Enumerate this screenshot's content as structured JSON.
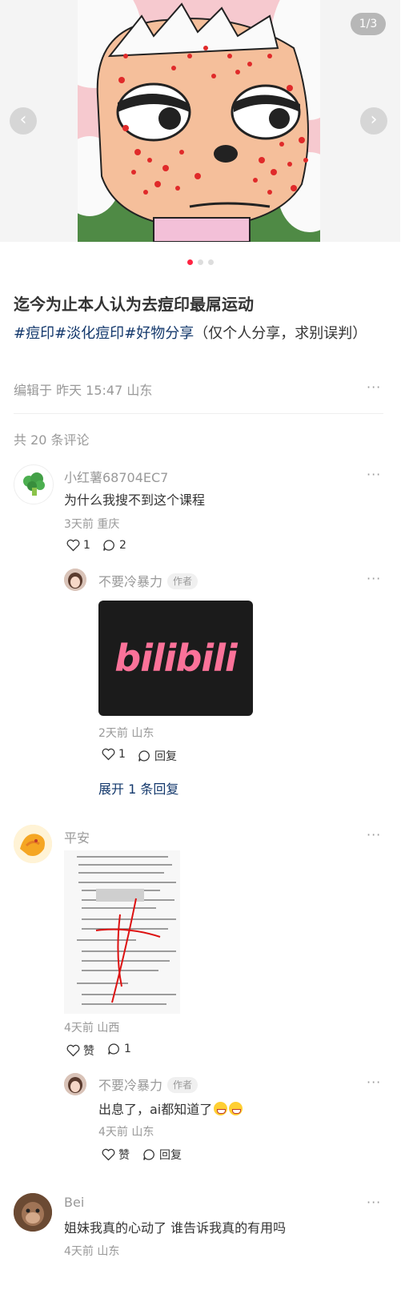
{
  "carousel": {
    "counter": "1/3",
    "prev_icon": "chevron-left-icon",
    "next_icon": "chevron-right-icon",
    "slide_count": 3,
    "active_slide": 1
  },
  "note": {
    "title": "迄今为止本人认为去痘印最屌运动",
    "tags": [
      "#痘印",
      "#淡化痘印",
      "#好物分享"
    ],
    "desc_text": "（仅个人分享，求别误判）",
    "meta": "编辑于 昨天 15:47 山东",
    "more": "···"
  },
  "comments_count": "共 20 条评论",
  "comments": [
    {
      "user": "小红薯68704EC7",
      "text": "为什么我搜不到这个课程",
      "meta": "3天前 重庆",
      "like": "1",
      "reply": "2",
      "more": "···",
      "replies": [
        {
          "user": "不要冷暴力",
          "badge": "作者",
          "image_text": "bilibili",
          "meta": "2天前 山东",
          "like": "1",
          "reply": "回复",
          "more": "···"
        }
      ],
      "expand": "展开 1 条回复"
    },
    {
      "user": "平安",
      "meta": "4天前 山西",
      "like": "赞",
      "reply": "1",
      "more": "···",
      "replies": [
        {
          "user": "不要冷暴力",
          "badge": "作者",
          "text": "出息了，ai都知道了",
          "meta": "4天前 山东",
          "like": "赞",
          "reply": "回复",
          "more": "···"
        }
      ]
    },
    {
      "user": "Bei",
      "text": "姐妹我真的心动了 谁告诉我真的有用吗",
      "meta": "4天前 山东",
      "more": "···"
    }
  ],
  "colors": {
    "accent": "#ff2442",
    "tag": "#13386c",
    "muted": "#999999",
    "bilibili_pink": "#fb7299"
  }
}
